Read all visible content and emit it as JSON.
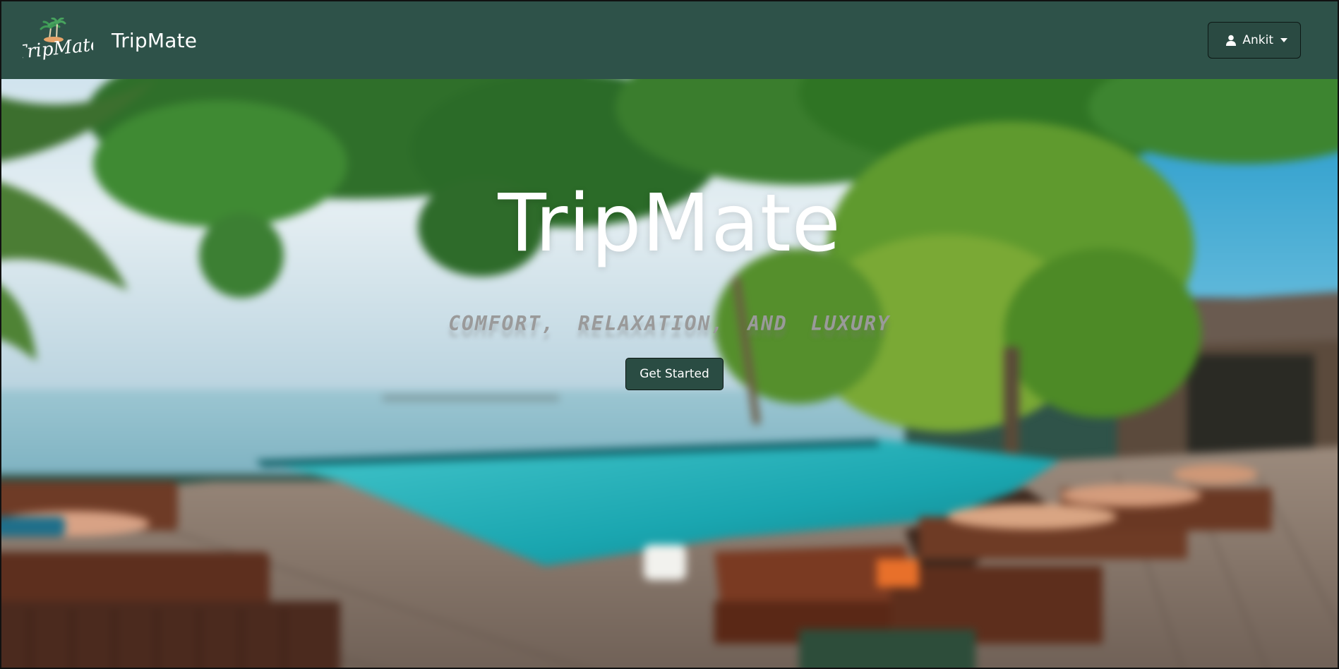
{
  "navbar": {
    "logo_text": "TripMate",
    "brand_name": "TripMate",
    "user_menu": {
      "label": "Ankit",
      "icon": "user-icon"
    }
  },
  "hero": {
    "title": "TripMate",
    "tagline": "COMFORT, RELAXATION, AND LUXURY",
    "cta_label": "Get Started",
    "background": "resort-pool-beach-photo"
  },
  "colors": {
    "navbar_bg": "#2e5249",
    "button_bg": "#2a4c43",
    "title_text": "#ffffff",
    "tagline_text": "#9a9a9a"
  }
}
